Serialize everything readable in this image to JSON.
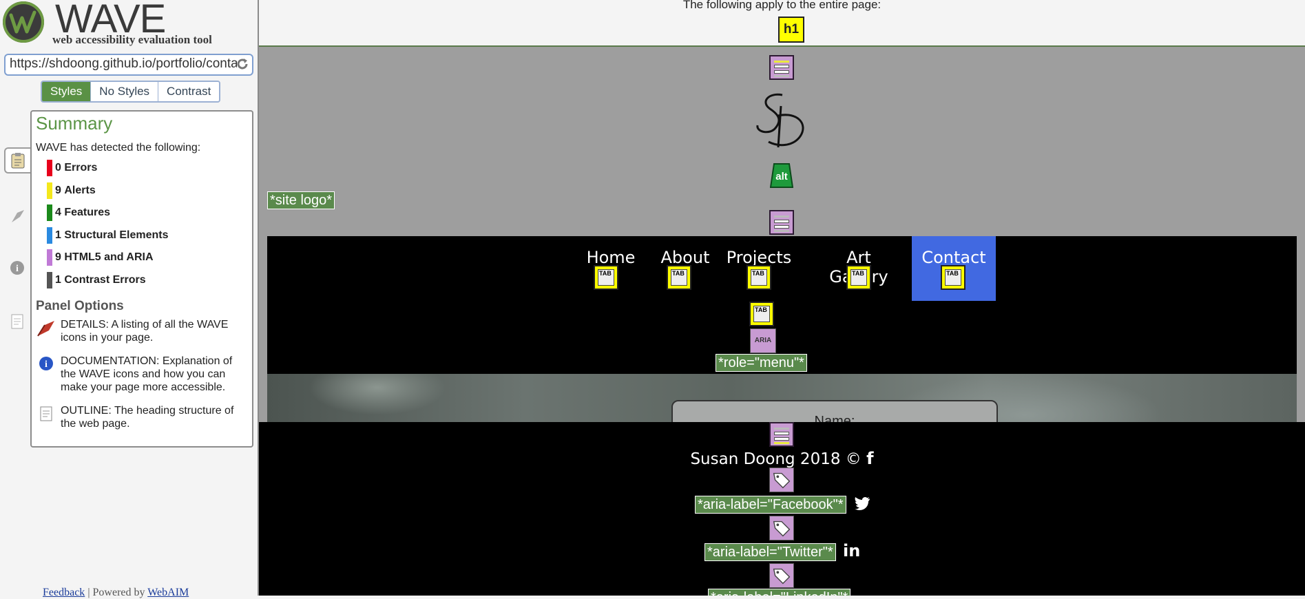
{
  "sidebar": {
    "logo_word": "WAVE",
    "logo_tagline": "web accessibility evaluation tool",
    "url": "https://shdoong.github.io/portfolio/contact",
    "view_tabs": [
      "Styles",
      "No Styles",
      "Contrast"
    ],
    "active_view": "Styles",
    "summary_title": "Summary",
    "detected_text": "WAVE has detected the following:",
    "summary_items": [
      {
        "count": "0",
        "label": "Errors",
        "color": "#e8001c"
      },
      {
        "count": "9",
        "label": "Alerts",
        "color": "#f4e81c"
      },
      {
        "count": "4",
        "label": "Features",
        "color": "#1c8a1c"
      },
      {
        "count": "1",
        "label": "Structural Elements",
        "color": "#2a8ae0"
      },
      {
        "count": "9",
        "label": "HTML5 and ARIA",
        "color": "#c07ad6"
      },
      {
        "count": "1",
        "label": "Contrast Errors",
        "color": "#555555"
      }
    ],
    "panel_options_title": "Panel Options",
    "options": [
      {
        "icon": "details-icon",
        "text": "DETAILS: A listing of all the WAVE icons in your page."
      },
      {
        "icon": "documentation-icon",
        "text": "DOCUMENTATION: Explanation of the WAVE icons and how you can make your page more accessible."
      },
      {
        "icon": "outline-icon",
        "text": "OUTLINE: The heading structure of the web page."
      }
    ],
    "footer_feedback": "Feedback",
    "footer_sep": " | ",
    "footer_powered": "Powered by ",
    "footer_webaim": "WebAIM"
  },
  "page": {
    "top_note": "The following apply to the entire page:",
    "h1_badge": "h1",
    "alt_badge": "alt",
    "site_logo_label": "*site logo*",
    "nav": [
      "Home",
      "About",
      "Projects",
      "Art Gallery",
      "Contact"
    ],
    "active_nav": "Contact",
    "tab_badge": "TAB",
    "aria_badge": "ARIA",
    "role_menu_label": "*role=\"menu\"*",
    "name_field_label": "Name:",
    "copyright": "Susan Doong 2018 ©",
    "aria_facebook": "*aria-label=\"Facebook\"*",
    "aria_twitter": "*aria-label=\"Twitter\"*",
    "aria_linkedin": "*aria-label=\"LinkedIn\"*",
    "social_facebook": "f",
    "social_linkedin": "in"
  }
}
